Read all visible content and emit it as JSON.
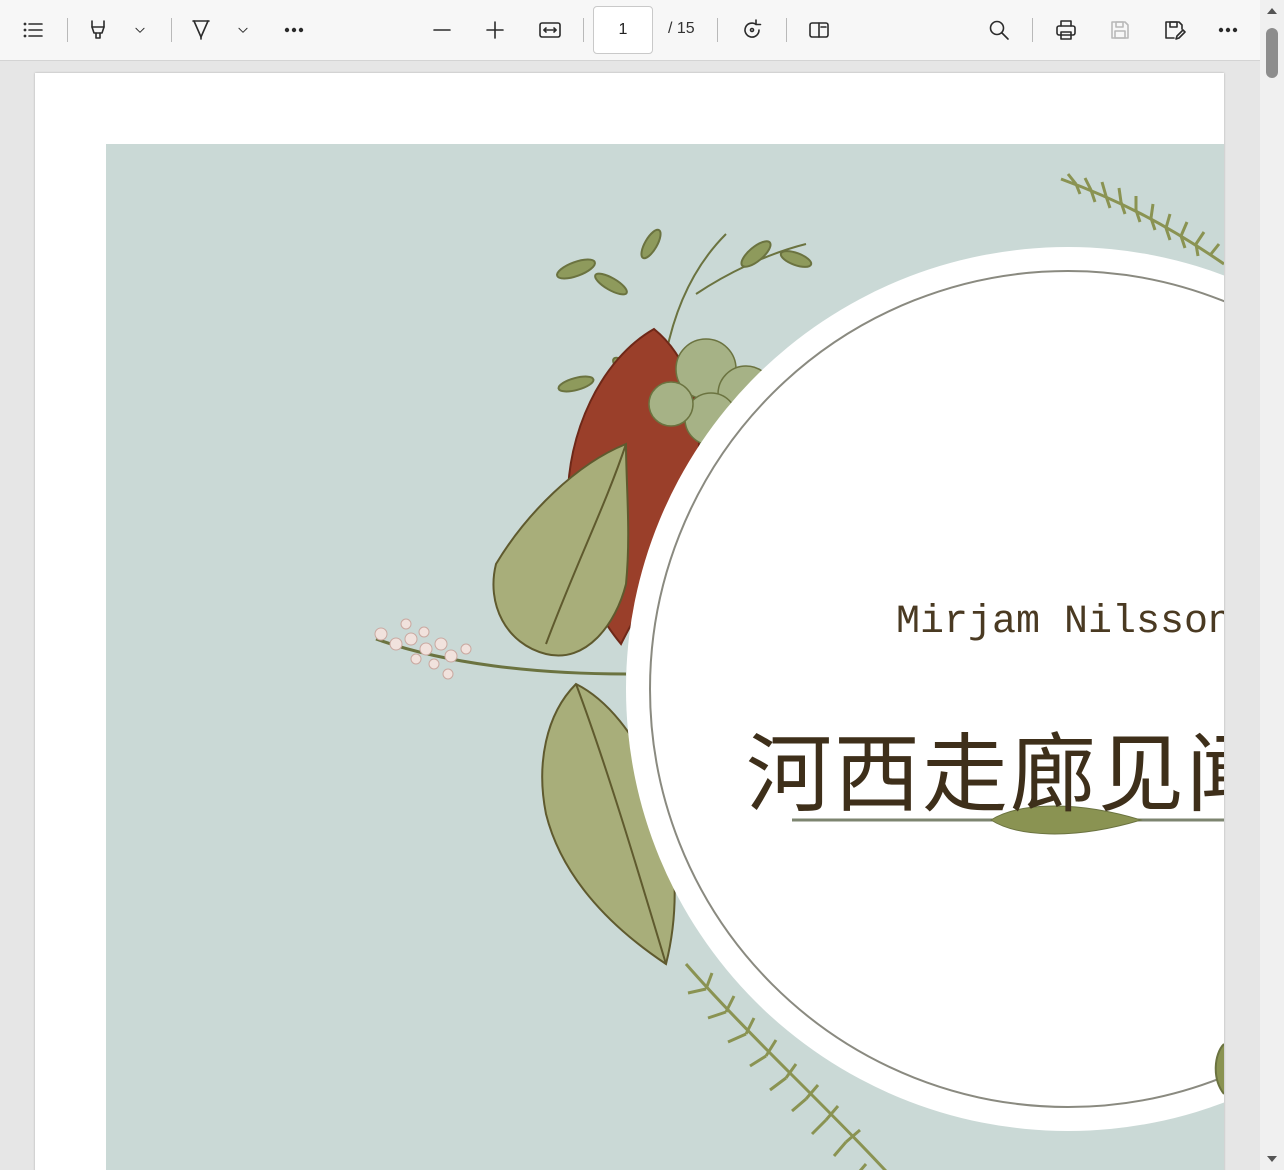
{
  "toolbar": {
    "icons": [
      "contents-icon",
      "highlight-icon",
      "draw-icon",
      "more-tools-icon",
      "zoom-out-icon",
      "zoom-in-icon",
      "fit-width-icon",
      "rotate-icon",
      "page-view-icon",
      "search-icon",
      "print-icon",
      "save-icon",
      "save-as-icon",
      "more-icon"
    ],
    "page_number": "1",
    "page_total": "/ 15"
  },
  "document": {
    "author": "Mirjam Nilsson",
    "title": "河西走廊见闻"
  },
  "colors": {
    "background_teal": "#cad9d6",
    "leaf_green": "#9aa36d",
    "dark_olive": "#5f5a2e",
    "rust_leaf": "#9a3f2a",
    "title_brown": "#3e2f1a"
  }
}
